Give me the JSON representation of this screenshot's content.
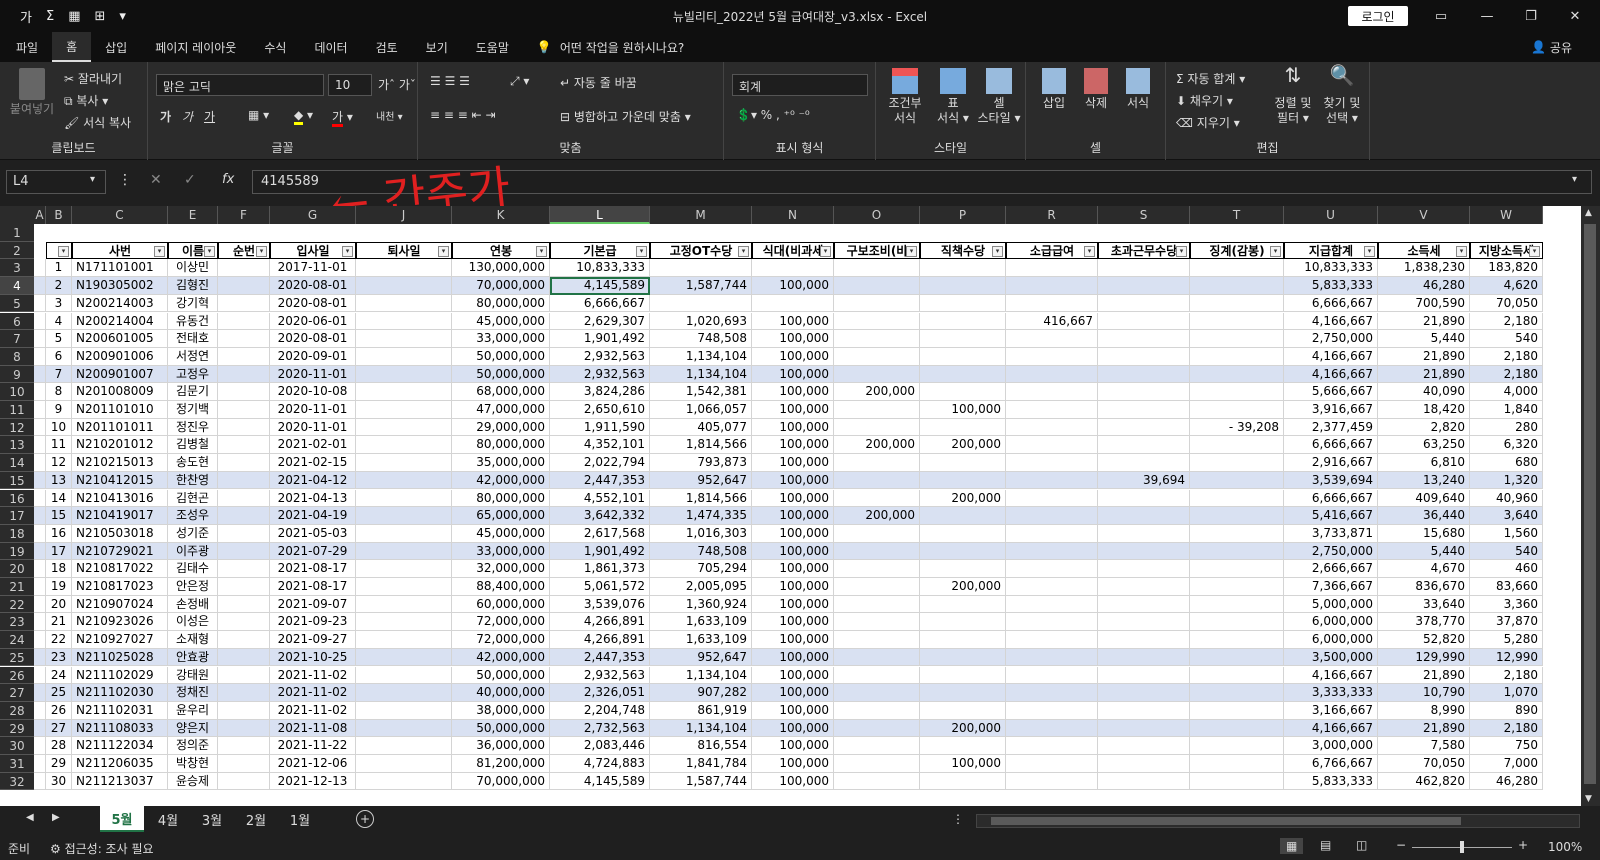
{
  "window": {
    "title": "뉴빌리티_2022년 5월 급여대장_v3.xlsx  -  Excel",
    "login": "로그인"
  },
  "qat": [
    "가",
    "Σ",
    "▦",
    "⊞",
    "▾"
  ],
  "menu": [
    "파일",
    "홈",
    "삽입",
    "페이지 레이아웃",
    "수식",
    "데이터",
    "검토",
    "보기",
    "도움말"
  ],
  "menu_search": "어떤 작업을 원하시나요?",
  "menu_share": "공유",
  "ribbon": {
    "clipboard": {
      "paste": "붙여넣기",
      "cut": "잘라내기",
      "copy": "복사",
      "format_painter": "서식 복사",
      "label": "클립보드"
    },
    "font": {
      "name": "맑은 고딕",
      "size": "10",
      "label": "글꼴",
      "bold": "가",
      "italic": "가",
      "underline": "가"
    },
    "align": {
      "wrap": "자동 줄 바꿈",
      "merge": "병합하고 가운데 맞춤",
      "label": "맞춤"
    },
    "number": {
      "format": "회계",
      "label": "표시 형식"
    },
    "styles": {
      "cond": "조건부\n서식",
      "table": "표\n서식",
      "cell": "셀\n스타일",
      "label": "스타일"
    },
    "cells": {
      "insert": "삽입",
      "delete": "삭제",
      "format": "서식",
      "label": "셀"
    },
    "edit": {
      "autosum": "자동 합계",
      "fill": "채우기",
      "clear": "지우기",
      "sort": "정렬 및\n필터",
      "find": "찾기 및\n선택",
      "label": "편집"
    }
  },
  "formula": {
    "namebox": "L4",
    "fx": "fx",
    "value": "4145589"
  },
  "annotation": "← 간주가",
  "columns": [
    {
      "letter": "A",
      "w": 12
    },
    {
      "letter": "B",
      "w": 26
    },
    {
      "letter": "C",
      "w": 96
    },
    {
      "letter": "E",
      "w": 50
    },
    {
      "letter": "F",
      "w": 52
    },
    {
      "letter": "G",
      "w": 86
    },
    {
      "letter": "J",
      "w": 96
    },
    {
      "letter": "K",
      "w": 98
    },
    {
      "letter": "L",
      "w": 100
    },
    {
      "letter": "M",
      "w": 102
    },
    {
      "letter": "N",
      "w": 82
    },
    {
      "letter": "O",
      "w": 86
    },
    {
      "letter": "P",
      "w": 86
    },
    {
      "letter": "R",
      "w": 92
    },
    {
      "letter": "S",
      "w": 92
    },
    {
      "letter": "T",
      "w": 94
    },
    {
      "letter": "U",
      "w": 94
    },
    {
      "letter": "V",
      "w": 92
    },
    {
      "letter": "W",
      "w": 73
    }
  ],
  "headers": [
    "",
    "",
    "사번",
    "이름",
    "순번",
    "입사일",
    "퇴사일",
    "연봉",
    "기본급",
    "고정OT수당",
    "식대(비과세",
    "구보조비(비",
    "직책수당",
    "소급급여",
    "초과근무수당",
    "징계(감봉)",
    "지급합계",
    "소득세",
    "지방소득세"
  ],
  "rows": [
    [
      1,
      "N171101001",
      "이상민",
      "",
      "2017-11-01",
      "",
      "130,000,000",
      "10,833,333",
      "",
      "",
      "",
      "",
      "",
      "",
      "",
      "10,833,333",
      "1,838,230",
      "183,820"
    ],
    [
      2,
      "N190305002",
      "김형진",
      "",
      "2020-08-01",
      "",
      "70,000,000",
      "4,145,589",
      "1,587,744",
      "100,000",
      "",
      "",
      "",
      "",
      "",
      "5,833,333",
      "46,280",
      "4,620"
    ],
    [
      3,
      "N200214003",
      "강기혁",
      "",
      "2020-08-01",
      "",
      "80,000,000",
      "6,666,667",
      "",
      "",
      "",
      "",
      "",
      "",
      "",
      "6,666,667",
      "700,590",
      "70,050"
    ],
    [
      4,
      "N200214004",
      "유동건",
      "",
      "2020-06-01",
      "",
      "45,000,000",
      "2,629,307",
      "1,020,693",
      "100,000",
      "",
      "",
      "416,667",
      "",
      "",
      "4,166,667",
      "21,890",
      "2,180"
    ],
    [
      5,
      "N200601005",
      "전태호",
      "",
      "2020-08-01",
      "",
      "33,000,000",
      "1,901,492",
      "748,508",
      "100,000",
      "",
      "",
      "",
      "",
      "",
      "2,750,000",
      "5,440",
      "540"
    ],
    [
      6,
      "N200901006",
      "서정연",
      "",
      "2020-09-01",
      "",
      "50,000,000",
      "2,932,563",
      "1,134,104",
      "100,000",
      "",
      "",
      "",
      "",
      "",
      "4,166,667",
      "21,890",
      "2,180"
    ],
    [
      7,
      "N200901007",
      "고정우",
      "",
      "2020-11-01",
      "",
      "50,000,000",
      "2,932,563",
      "1,134,104",
      "100,000",
      "",
      "",
      "",
      "",
      "",
      "4,166,667",
      "21,890",
      "2,180"
    ],
    [
      8,
      "N201008009",
      "김문기",
      "",
      "2020-10-08",
      "",
      "68,000,000",
      "3,824,286",
      "1,542,381",
      "100,000",
      "200,000",
      "",
      "",
      "",
      "",
      "5,666,667",
      "40,090",
      "4,000"
    ],
    [
      9,
      "N201101010",
      "정기백",
      "",
      "2020-11-01",
      "",
      "47,000,000",
      "2,650,610",
      "1,066,057",
      "100,000",
      "",
      "100,000",
      "",
      "",
      "",
      "3,916,667",
      "18,420",
      "1,840"
    ],
    [
      10,
      "N201101011",
      "정진우",
      "",
      "2020-11-01",
      "",
      "29,000,000",
      "1,911,590",
      "405,077",
      "100,000",
      "",
      "",
      "",
      "",
      "-    39,208",
      "2,377,459",
      "2,820",
      "280"
    ],
    [
      11,
      "N210201012",
      "김병철",
      "",
      "2021-02-01",
      "",
      "80,000,000",
      "4,352,101",
      "1,814,566",
      "100,000",
      "200,000",
      "200,000",
      "",
      "",
      "",
      "6,666,667",
      "63,250",
      "6,320"
    ],
    [
      12,
      "N210215013",
      "송도현",
      "",
      "2021-02-15",
      "",
      "35,000,000",
      "2,022,794",
      "793,873",
      "100,000",
      "",
      "",
      "",
      "",
      "",
      "2,916,667",
      "6,810",
      "680"
    ],
    [
      13,
      "N210412015",
      "한찬영",
      "",
      "2021-04-12",
      "",
      "42,000,000",
      "2,447,353",
      "952,647",
      "100,000",
      "",
      "",
      "",
      "39,694",
      "",
      "3,539,694",
      "13,240",
      "1,320"
    ],
    [
      14,
      "N210413016",
      "김현곤",
      "",
      "2021-04-13",
      "",
      "80,000,000",
      "4,552,101",
      "1,814,566",
      "100,000",
      "",
      "200,000",
      "",
      "",
      "",
      "6,666,667",
      "409,640",
      "40,960"
    ],
    [
      15,
      "N210419017",
      "조성우",
      "",
      "2021-04-19",
      "",
      "65,000,000",
      "3,642,332",
      "1,474,335",
      "100,000",
      "200,000",
      "",
      "",
      "",
      "",
      "5,416,667",
      "36,440",
      "3,640"
    ],
    [
      16,
      "N210503018",
      "성기준",
      "",
      "2021-05-03",
      "",
      "45,000,000",
      "2,617,568",
      "1,016,303",
      "100,000",
      "",
      "",
      "",
      "",
      "",
      "3,733,871",
      "15,680",
      "1,560"
    ],
    [
      17,
      "N210729021",
      "이주광",
      "",
      "2021-07-29",
      "",
      "33,000,000",
      "1,901,492",
      "748,508",
      "100,000",
      "",
      "",
      "",
      "",
      "",
      "2,750,000",
      "5,440",
      "540"
    ],
    [
      18,
      "N210817022",
      "김태수",
      "",
      "2021-08-17",
      "",
      "32,000,000",
      "1,861,373",
      "705,294",
      "100,000",
      "",
      "",
      "",
      "",
      "",
      "2,666,667",
      "4,670",
      "460"
    ],
    [
      19,
      "N210817023",
      "안은정",
      "",
      "2021-08-17",
      "",
      "88,400,000",
      "5,061,572",
      "2,005,095",
      "100,000",
      "",
      "200,000",
      "",
      "",
      "",
      "7,366,667",
      "836,670",
      "83,660"
    ],
    [
      20,
      "N210907024",
      "손정배",
      "",
      "2021-09-07",
      "",
      "60,000,000",
      "3,539,076",
      "1,360,924",
      "100,000",
      "",
      "",
      "",
      "",
      "",
      "5,000,000",
      "33,640",
      "3,360"
    ],
    [
      21,
      "N210923026",
      "이성은",
      "",
      "2021-09-23",
      "",
      "72,000,000",
      "4,266,891",
      "1,633,109",
      "100,000",
      "",
      "",
      "",
      "",
      "",
      "6,000,000",
      "378,770",
      "37,870"
    ],
    [
      22,
      "N210927027",
      "소재형",
      "",
      "2021-09-27",
      "",
      "72,000,000",
      "4,266,891",
      "1,633,109",
      "100,000",
      "",
      "",
      "",
      "",
      "",
      "6,000,000",
      "52,820",
      "5,280"
    ],
    [
      23,
      "N211025028",
      "안효광",
      "",
      "2021-10-25",
      "",
      "42,000,000",
      "2,447,353",
      "952,647",
      "100,000",
      "",
      "",
      "",
      "",
      "",
      "3,500,000",
      "129,990",
      "12,990"
    ],
    [
      24,
      "N211102029",
      "강태원",
      "",
      "2021-11-02",
      "",
      "50,000,000",
      "2,932,563",
      "1,134,104",
      "100,000",
      "",
      "",
      "",
      "",
      "",
      "4,166,667",
      "21,890",
      "2,180"
    ],
    [
      25,
      "N211102030",
      "정채진",
      "",
      "2021-11-02",
      "",
      "40,000,000",
      "2,326,051",
      "907,282",
      "100,000",
      "",
      "",
      "",
      "",
      "",
      "3,333,333",
      "10,790",
      "1,070"
    ],
    [
      26,
      "N211102031",
      "윤우리",
      "",
      "2021-11-02",
      "",
      "38,000,000",
      "2,204,748",
      "861,919",
      "100,000",
      "",
      "",
      "",
      "",
      "",
      "3,166,667",
      "8,990",
      "890"
    ],
    [
      27,
      "N211108033",
      "양은지",
      "",
      "2021-11-08",
      "",
      "50,000,000",
      "2,732,563",
      "1,134,104",
      "100,000",
      "",
      "200,000",
      "",
      "",
      "",
      "4,166,667",
      "21,890",
      "2,180"
    ],
    [
      28,
      "N211122034",
      "정의준",
      "",
      "2021-11-22",
      "",
      "36,000,000",
      "2,083,446",
      "816,554",
      "100,000",
      "",
      "",
      "",
      "",
      "",
      "3,000,000",
      "7,580",
      "750"
    ],
    [
      29,
      "N211206035",
      "박창현",
      "",
      "2021-12-06",
      "",
      "81,200,000",
      "4,724,883",
      "1,841,784",
      "100,000",
      "",
      "100,000",
      "",
      "",
      "",
      "6,766,667",
      "70,050",
      "7,000"
    ],
    [
      30,
      "N211213037",
      "윤승제",
      "",
      "2021-12-13",
      "",
      "70,000,000",
      "4,145,589",
      "1,587,744",
      "100,000",
      "",
      "",
      "",
      "",
      "",
      "5,833,333",
      "462,820",
      "46,280"
    ]
  ],
  "banded_rows": [
    4,
    9,
    15,
    17,
    19,
    25,
    27,
    29
  ],
  "tabs": [
    "5월",
    "4월",
    "3월",
    "2월",
    "1월"
  ],
  "status": {
    "ready": "준비",
    "access": "접근성: 조사 필요",
    "zoom": "100%"
  }
}
